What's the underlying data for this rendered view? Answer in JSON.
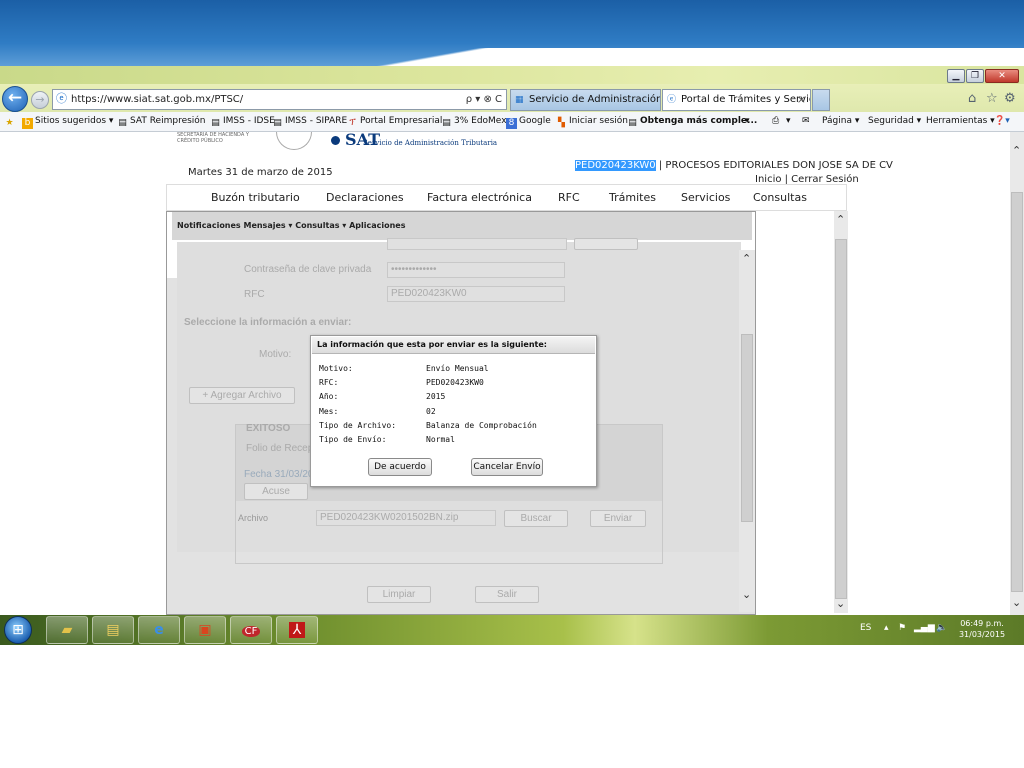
{
  "browser": {
    "address": "https://www.siat.sat.gob.mx/PTSC/",
    "address_controls": "ρ ▾ ⊗ C",
    "tabs": [
      {
        "label": "Servicio de Administración Tri...",
        "active": false
      },
      {
        "label": "Portal de Trámites y Servici...",
        "active": true
      }
    ],
    "tab_close": "×"
  },
  "favorites": {
    "items": [
      "Sitios sugeridos ▾",
      "SAT Reimpresión",
      "IMSS - IDSE",
      "IMSS - SIPARE",
      "Portal Empresarial",
      "3% EdoMex",
      "Google",
      "Iniciar sesión",
      "Obtenga más comple...",
      "▾"
    ],
    "commands": [
      "▾",
      "Página ▾",
      "Seguridad ▾",
      "Herramientas ▾"
    ]
  },
  "header": {
    "agency_small": "SECRETARÍA DE HACIENDA Y CRÉDITO PÚBLICO",
    "logo": "SAT",
    "logo_sub": "Servicio de Administración Tributaria",
    "date": "Martes 31 de marzo de 2015",
    "rfc_highlight": "PED020423KW0",
    "company": "| PROCESOS EDITORIALES DON JOSE SA DE CV",
    "login_links": "Inicio | Cerrar Sesión"
  },
  "menu": [
    "Buzón tributario",
    "Declaraciones",
    "Factura electrónica",
    "RFC",
    "Trámites",
    "Servicios",
    "Consultas"
  ],
  "subnav": "Notificaciones  Mensajes  ▾ Consultas  ▾ Aplicaciones",
  "form": {
    "password_label": "Contraseña de clave privada",
    "password_value": "•••••••••••••",
    "rfc_label": "RFC",
    "rfc_value": "PED020423KW0",
    "select_heading": "Seleccione la información a enviar:",
    "motivo_label": "Motivo:",
    "add_file": "+ Agregar Archivo",
    "success_title": "EXITOSO",
    "folio_label": "Folio de Recep",
    "fecha_label": "Fecha 31/03/20",
    "acuse_button": "Acuse",
    "archivo_label": "Archivo",
    "archivo_value": "PED020423KW0201502BN.zip",
    "buscar_button": "Buscar",
    "enviar_button": "Enviar",
    "limpiar_button": "Limpiar",
    "salir_button": "Salir"
  },
  "modal": {
    "title": "La información que esta por enviar es la siguiente:",
    "rows": [
      {
        "label": "Motivo:",
        "value": "Envío Mensual"
      },
      {
        "label": "RFC:",
        "value": "PED020423KW0"
      },
      {
        "label": "Año:",
        "value": "2015"
      },
      {
        "label": "Mes:",
        "value": "02"
      },
      {
        "label": "Tipo de Archivo:",
        "value": "Balanza de Comprobación"
      },
      {
        "label": "Tipo de Envío:",
        "value": "Normal"
      }
    ],
    "accept": "De acuerdo",
    "cancel": "Cancelar Envío"
  },
  "taskbar": {
    "lang": "ES",
    "clock_time": "06:49 p.m.",
    "clock_date": "31/03/2015"
  }
}
